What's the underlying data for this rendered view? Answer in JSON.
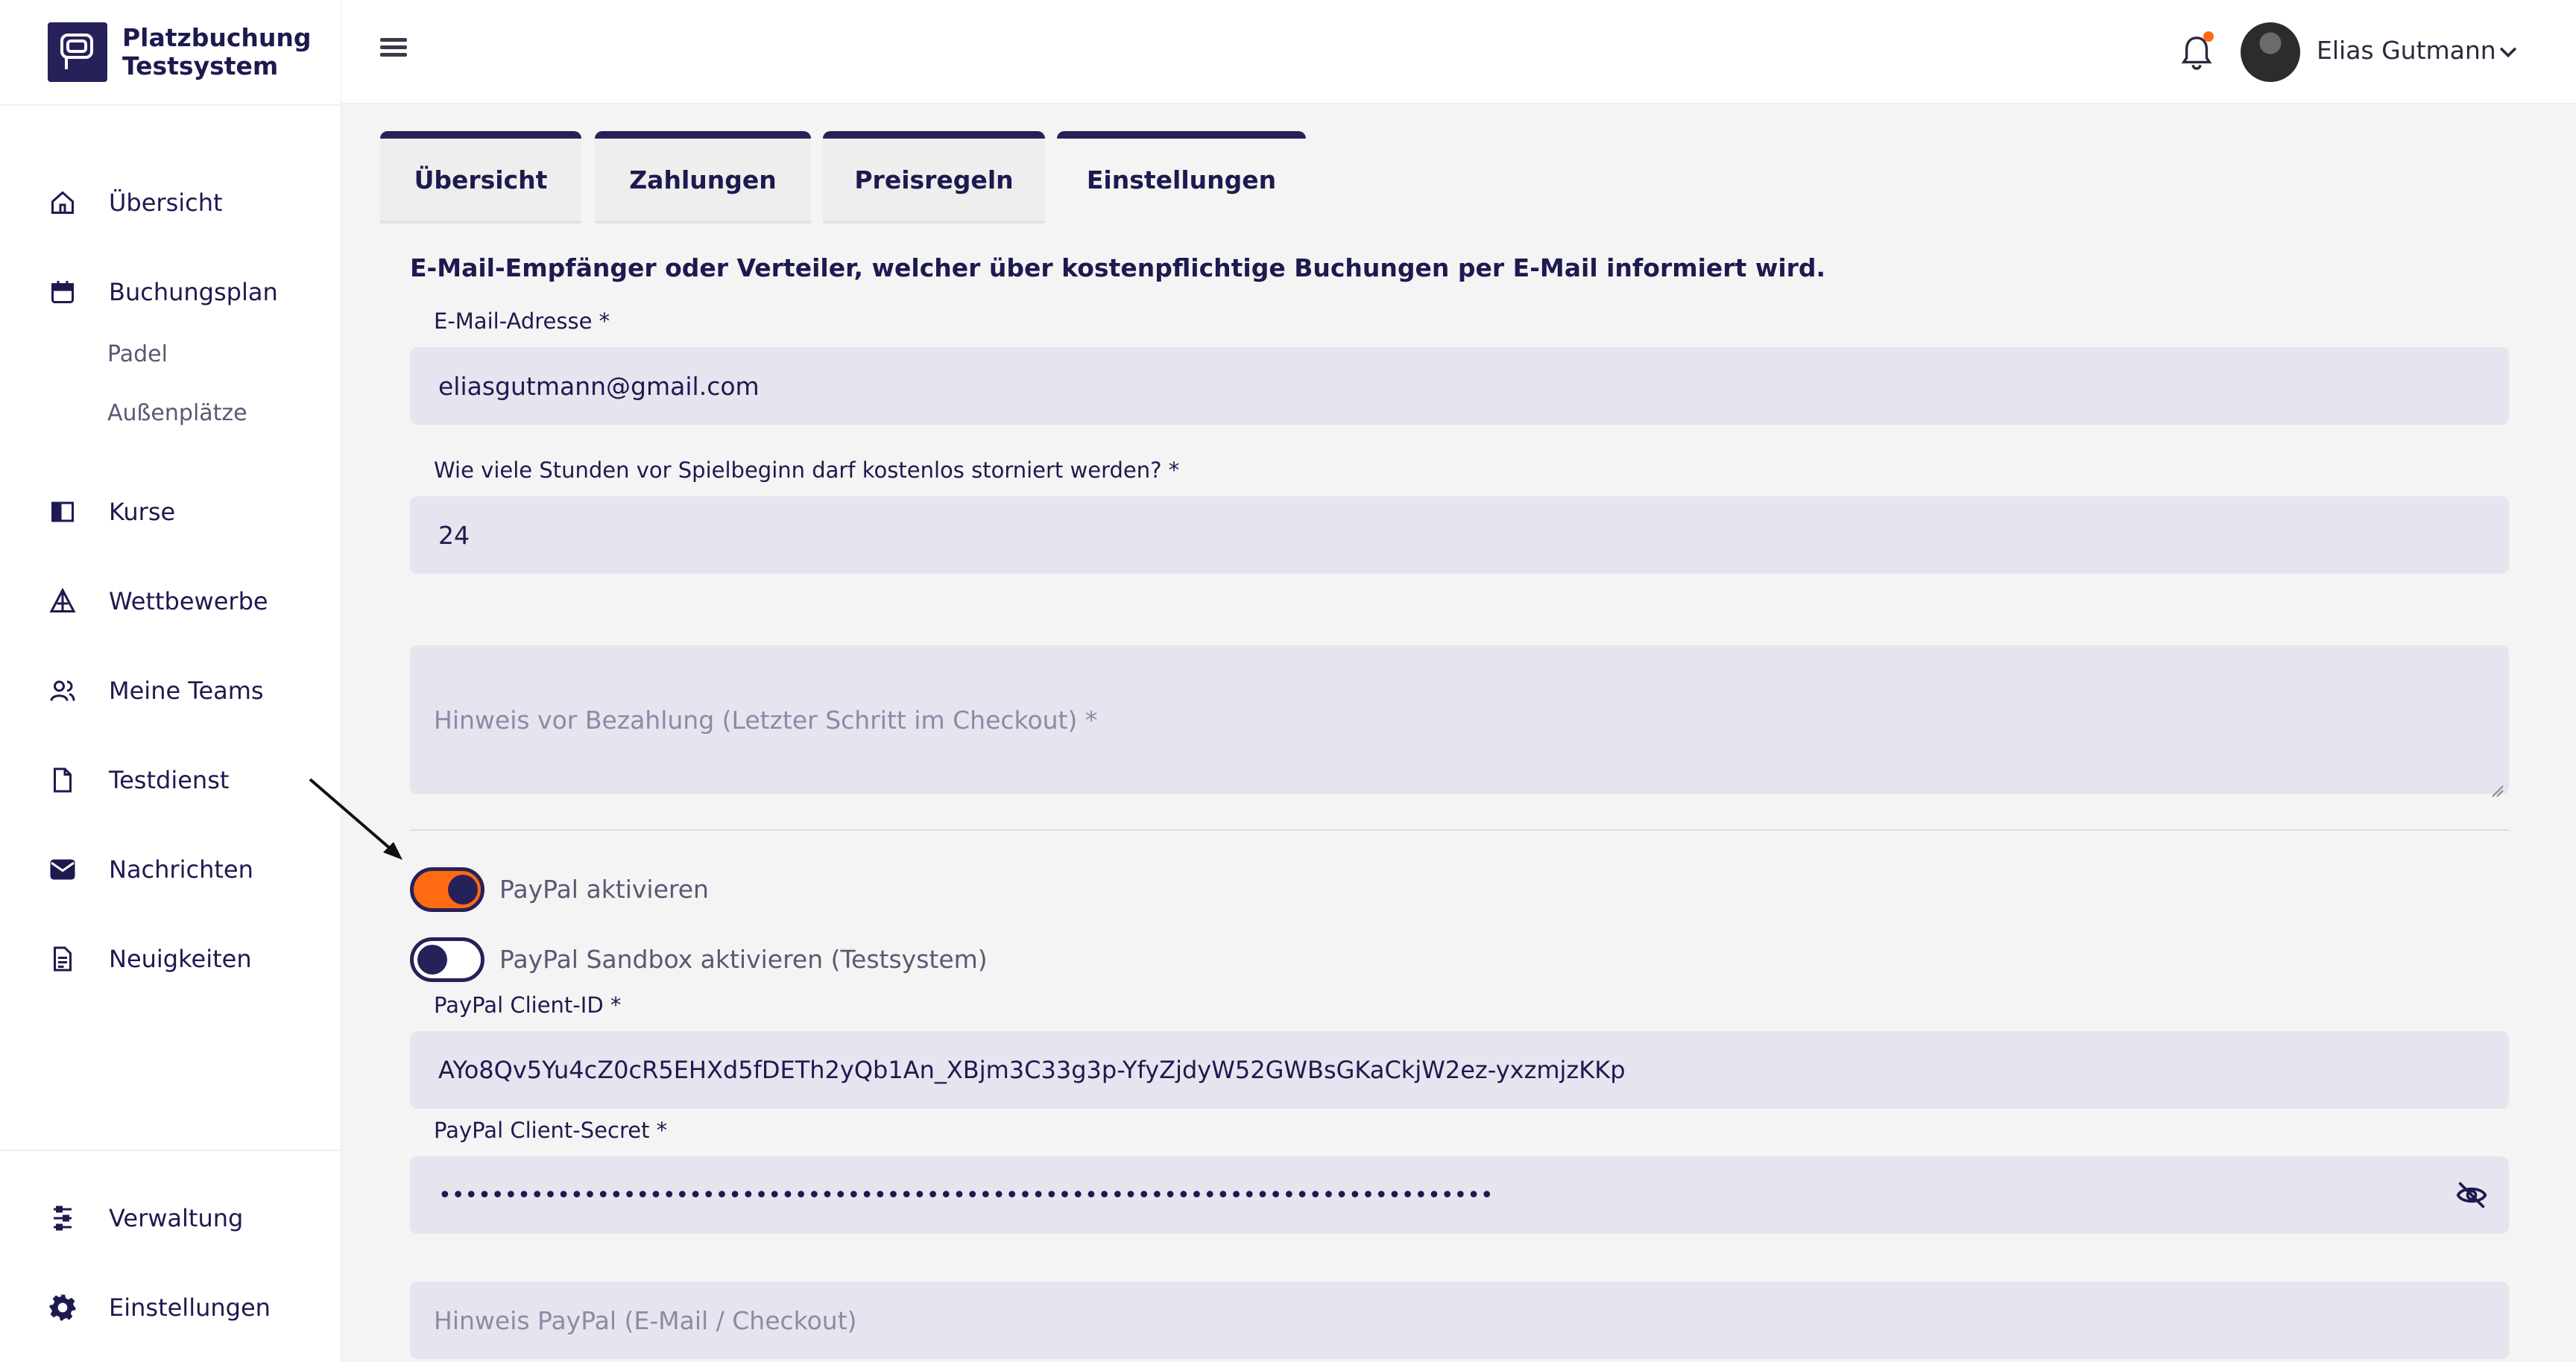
{
  "brand": {
    "name": "Platzbuchung\nTestsystem"
  },
  "sidebar": {
    "items": [
      {
        "label": "Übersicht",
        "icon": "home-icon"
      },
      {
        "label": "Buchungsplan",
        "icon": "calendar-icon"
      },
      {
        "label": "Kurse",
        "icon": "book-icon"
      },
      {
        "label": "Wettbewerbe",
        "icon": "trophy-icon"
      },
      {
        "label": "Meine Teams",
        "icon": "users-icon"
      },
      {
        "label": "Testdienst",
        "icon": "document-icon"
      },
      {
        "label": "Nachrichten",
        "icon": "mail-icon"
      },
      {
        "label": "Neuigkeiten",
        "icon": "news-icon"
      }
    ],
    "sub_items": [
      "Padel",
      "Außenplätze"
    ],
    "bottom_items": [
      {
        "label": "Verwaltung",
        "icon": "sliders-icon"
      },
      {
        "label": "Einstellungen",
        "icon": "gear-icon"
      }
    ]
  },
  "header": {
    "user_name": "Elias Gutmann",
    "notification_badge_color": "#ff6a13"
  },
  "tabs": [
    {
      "label": "Übersicht"
    },
    {
      "label": "Zahlungen"
    },
    {
      "label": "Preisregeln"
    },
    {
      "label": "Einstellungen",
      "active": true
    }
  ],
  "form": {
    "info_text": "E-Mail-Empfänger oder Verteiler, welcher über kostenpflichtige Buchungen per E-Mail informiert wird.",
    "email_label": "E-Mail-Adresse *",
    "email_value": "eliasgutmann@gmail.com",
    "hours_label": "Wie viele Stunden vor Spielbeginn darf kostenlos storniert werden? *",
    "hours_value": "24",
    "checkout_note_placeholder": "Hinweis vor Bezahlung (Letzter Schritt im Checkout) *",
    "paypal_toggle_label": "PayPal aktivieren",
    "paypal_enabled": true,
    "sandbox_toggle_label": "PayPal Sandbox aktivieren (Testsystem)",
    "sandbox_enabled": false,
    "client_id_label": "PayPal Client-ID *",
    "client_id_value": "AYo8Qv5Yu4cZ0cR5EHXd5fDETh2yQb1An_XBjm3C33g3p-YfyZjdyW52GWBsGKaCkjW2ez-yxzmjzKKp",
    "client_secret_label": "PayPal Client-Secret *",
    "client_secret_value": "••••••••••••••••••••••••••••••••••••••••••••••••••••••••••••••••••••••••••••••••",
    "paypal_note_placeholder": "Hinweis PayPal (E-Mail / Checkout)"
  },
  "colors": {
    "primary": "#27215a",
    "accent": "#ff6a13",
    "field_bg": "#e6e4ef"
  }
}
